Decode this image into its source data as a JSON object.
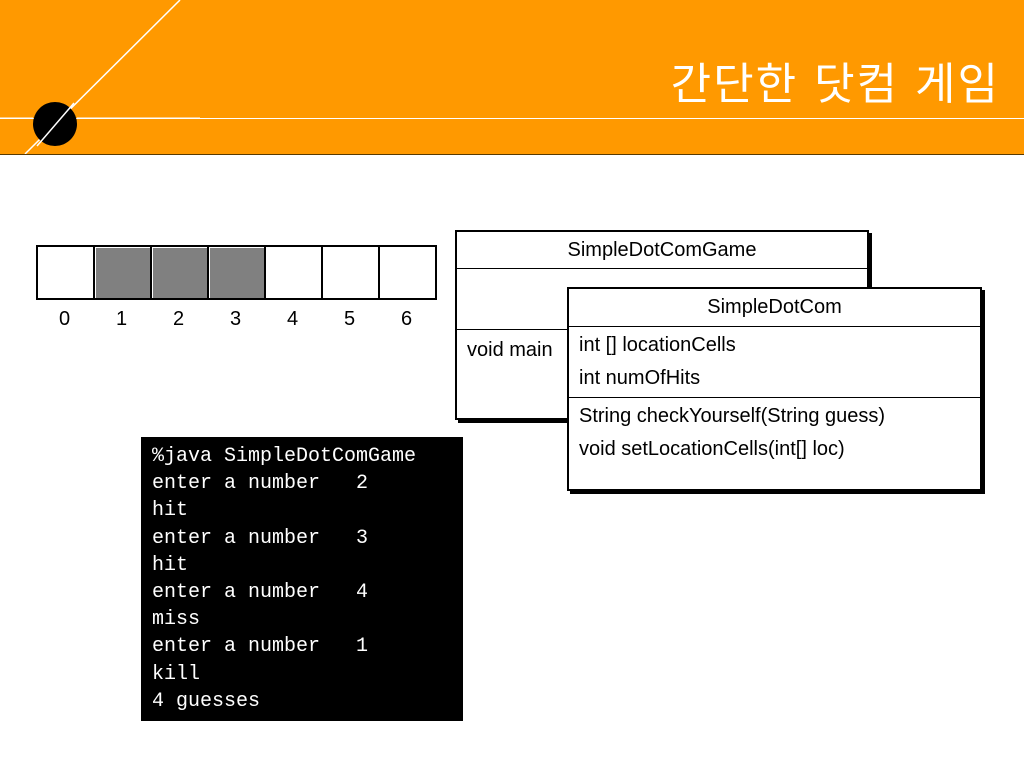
{
  "slide": {
    "title": "간단한 닷컴 게임"
  },
  "grid": {
    "cells": [
      {
        "index": "0",
        "filled": false
      },
      {
        "index": "1",
        "filled": true
      },
      {
        "index": "2",
        "filled": true
      },
      {
        "index": "3",
        "filled": true
      },
      {
        "index": "4",
        "filled": false
      },
      {
        "index": "5",
        "filled": false
      },
      {
        "index": "6",
        "filled": false
      }
    ]
  },
  "uml_game": {
    "name": "SimpleDotComGame",
    "attributes": [],
    "methods": [
      "void main"
    ]
  },
  "uml_dotcom": {
    "name": "SimpleDotCom",
    "attributes": [
      "int [] locationCells",
      "int numOfHits"
    ],
    "methods": [
      "String checkYourself(String guess)",
      "void setLocationCells(int[] loc)"
    ]
  },
  "console": {
    "lines": [
      "%java SimpleDotComGame",
      "enter a number   2",
      "hit",
      "enter a number   3",
      "hit",
      "enter a number   4",
      "miss",
      "enter a number   1",
      "kill",
      "4 guesses"
    ]
  },
  "colors": {
    "banner": "#ff9900",
    "filled_cell": "#808080",
    "console_bg": "#000000",
    "console_text": "#ffffff"
  }
}
